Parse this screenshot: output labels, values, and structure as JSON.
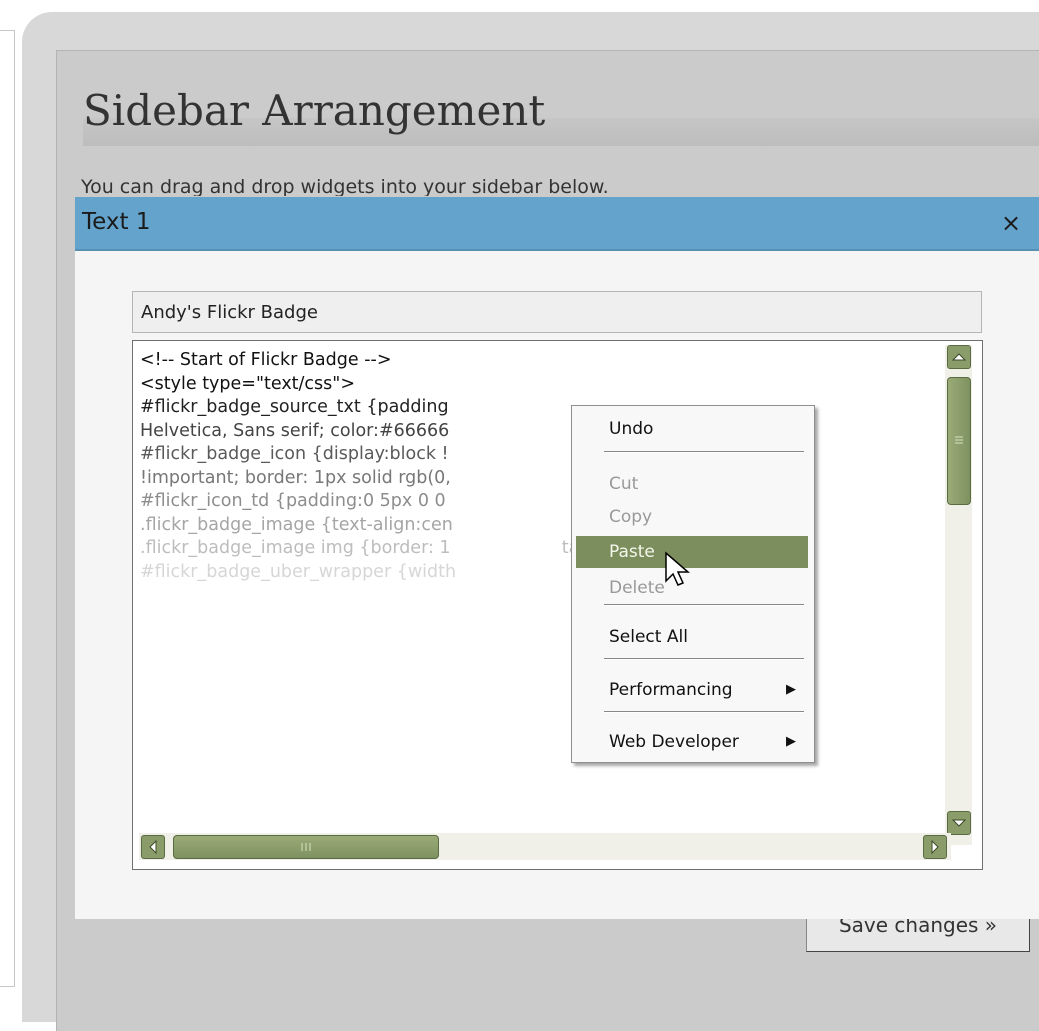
{
  "page": {
    "title": "Sidebar Arrangement",
    "intro": "You can drag and drop widgets into your sidebar below.",
    "save_button": "Save changes »"
  },
  "modal": {
    "title": "Text 1",
    "close_icon": "×",
    "title_field_value": "Andy's Flickr Badge",
    "code_lines": [
      "<!-- Start of Flickr Badge -->",
      "<style type=\"text/css\">",
      "#flickr_badge_source_txt {padding",
      "Helvetica, Sans serif; color:#66666",
      "#flickr_badge_icon {display:block !",
      "!important; border: 1px solid rgb(0,",
      "#flickr_icon_td {padding:0 5px 0 0",
      ".flickr_badge_image {text-align:cen",
      ".flickr_badge_image img {border: 1                    tant;}",
      "#flickr_badge_uber_wrapper {width"
    ],
    "code_colors": [
      "#111111",
      "#111111",
      "#222222",
      "#444444",
      "#5a5a5a",
      "#777777",
      "#8d8d8d",
      "#a5a5a5",
      "#bdbdbd",
      "#d6d6d6"
    ]
  },
  "context_menu": {
    "items": [
      {
        "label": "Undo",
        "underline": "U",
        "disabled": false,
        "highlight": false
      },
      {
        "label": "Cut",
        "underline": "t",
        "disabled": true,
        "highlight": false
      },
      {
        "label": "Copy",
        "underline": "C",
        "disabled": true,
        "highlight": false
      },
      {
        "label": "Paste",
        "underline": "P",
        "disabled": false,
        "highlight": true
      },
      {
        "label": "Delete",
        "underline": "D",
        "disabled": true,
        "highlight": false
      },
      {
        "label": "Select All",
        "underline": "A",
        "disabled": false,
        "highlight": false
      },
      {
        "label": "Performancing",
        "underline": "P",
        "disabled": false,
        "highlight": false,
        "submenu": true
      },
      {
        "label": "Web Developer",
        "underline": "e",
        "disabled": false,
        "highlight": false,
        "submenu": true
      }
    ],
    "submenu_arrow": "▶"
  },
  "icons": {
    "scroll_up": "up-arrow-icon",
    "scroll_down": "down-arrow-icon",
    "scroll_left": "left-arrow-icon",
    "scroll_right": "right-arrow-icon",
    "cursor": "mouse-pointer-icon"
  },
  "colors": {
    "modal_header": "#64a4cc",
    "scrollbar": "#8b9c6b",
    "menu_highlight": "#7d8e5e"
  }
}
